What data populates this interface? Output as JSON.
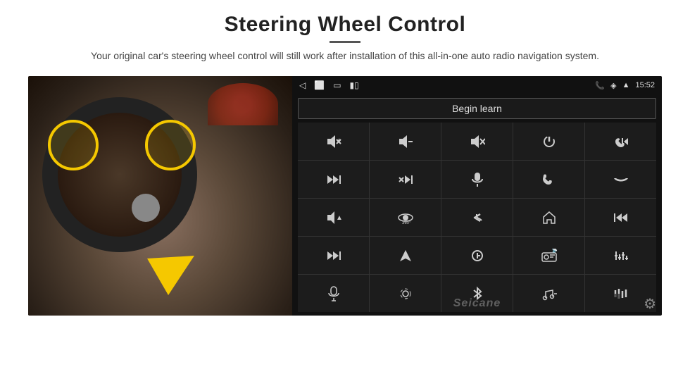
{
  "header": {
    "title": "Steering Wheel Control",
    "divider": true,
    "subtitle": "Your original car's steering wheel control will still work after installation of this all-in-one auto radio navigation system."
  },
  "android_ui": {
    "status_bar": {
      "back_icon": "◁",
      "home_icon": "⬜",
      "square_icon": "▭",
      "battery_icon": "▮▯",
      "phone_icon": "📞",
      "location_icon": "◈",
      "wifi_icon": "▲",
      "time": "15:52"
    },
    "begin_learn_label": "Begin learn",
    "controls": [
      {
        "icon": "🔊+",
        "label": "vol-up"
      },
      {
        "icon": "🔊−",
        "label": "vol-down"
      },
      {
        "icon": "🔇",
        "label": "mute"
      },
      {
        "icon": "⏻",
        "label": "power"
      },
      {
        "icon": "📞⏮",
        "label": "phone-prev"
      },
      {
        "icon": "⏭",
        "label": "next-track"
      },
      {
        "icon": "✗⏭",
        "label": "skip"
      },
      {
        "icon": "🎤",
        "label": "mic"
      },
      {
        "icon": "📞",
        "label": "call"
      },
      {
        "icon": "↩",
        "label": "hang-up"
      },
      {
        "icon": "📢",
        "label": "speaker"
      },
      {
        "icon": "⊙360",
        "label": "360cam"
      },
      {
        "icon": "↺",
        "label": "back"
      },
      {
        "icon": "⌂",
        "label": "home"
      },
      {
        "icon": "⏮⏮",
        "label": "prev"
      },
      {
        "icon": "⏭⏭",
        "label": "fast-forward"
      },
      {
        "icon": "▲",
        "label": "navigate"
      },
      {
        "icon": "⊖",
        "label": "source"
      },
      {
        "icon": "📻",
        "label": "radio"
      },
      {
        "icon": "≡|≡",
        "label": "eq"
      },
      {
        "icon": "🎵",
        "label": "microphone2"
      },
      {
        "icon": "⊙",
        "label": "settings2"
      },
      {
        "icon": "✱",
        "label": "bluetooth"
      },
      {
        "icon": "♪⚙",
        "label": "music-settings"
      },
      {
        "icon": "|||",
        "label": "levels"
      }
    ],
    "watermark": "Seicane",
    "gear_icon": "⚙"
  }
}
